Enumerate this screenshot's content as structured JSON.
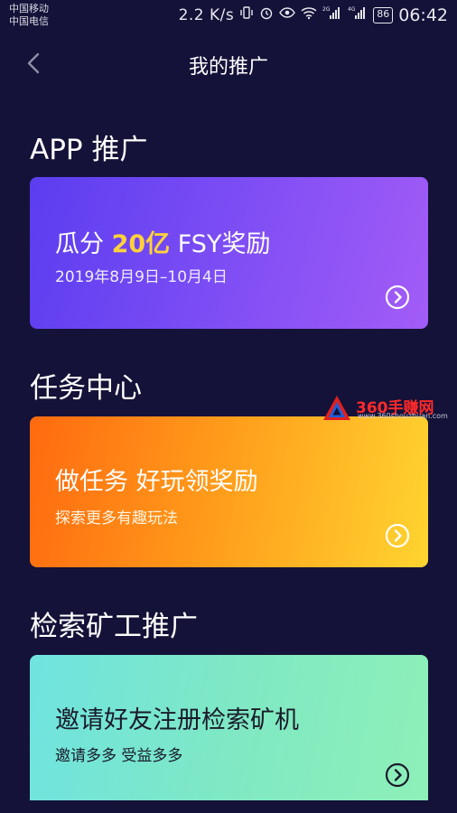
{
  "status_bar": {
    "carrier_1": "中国移动",
    "carrier_2": "中国电信",
    "net_speed": "2.2 K/s",
    "battery": "86",
    "time": "06:42",
    "signal_label_1": "2G",
    "signal_label_2": "4G",
    "icons": [
      "vibrate-icon",
      "alarm-icon",
      "eye-icon",
      "wifi-icon",
      "signal-icon",
      "signal-icon"
    ]
  },
  "nav": {
    "title": "我的推广",
    "back_icon": "chevron-left-icon"
  },
  "sections": [
    {
      "title": "APP 推广",
      "card": {
        "title_prefix": "瓜分 ",
        "title_highlight": "20亿",
        "title_suffix": " FSY奖励",
        "subtitle": "2019年8月9日–10月4日",
        "arrow_icon": "circle-chevron-right-icon"
      }
    },
    {
      "title": "任务中心",
      "card": {
        "title": "做任务 好玩领奖励",
        "subtitle": "探索更多有趣玩法",
        "arrow_icon": "circle-chevron-right-icon"
      }
    },
    {
      "title": "检索矿工推广",
      "card": {
        "title": "邀请好友注册检索矿机",
        "subtitle": "邀请多多 受益多多",
        "arrow_icon": "circle-chevron-right-icon"
      }
    }
  ],
  "watermark": {
    "name": "360手赚网",
    "url": "www.360shouzhuan.com"
  },
  "colors": {
    "background": "#141238",
    "highlight": "#ffd23a",
    "watermark": "#ff2a2a"
  }
}
